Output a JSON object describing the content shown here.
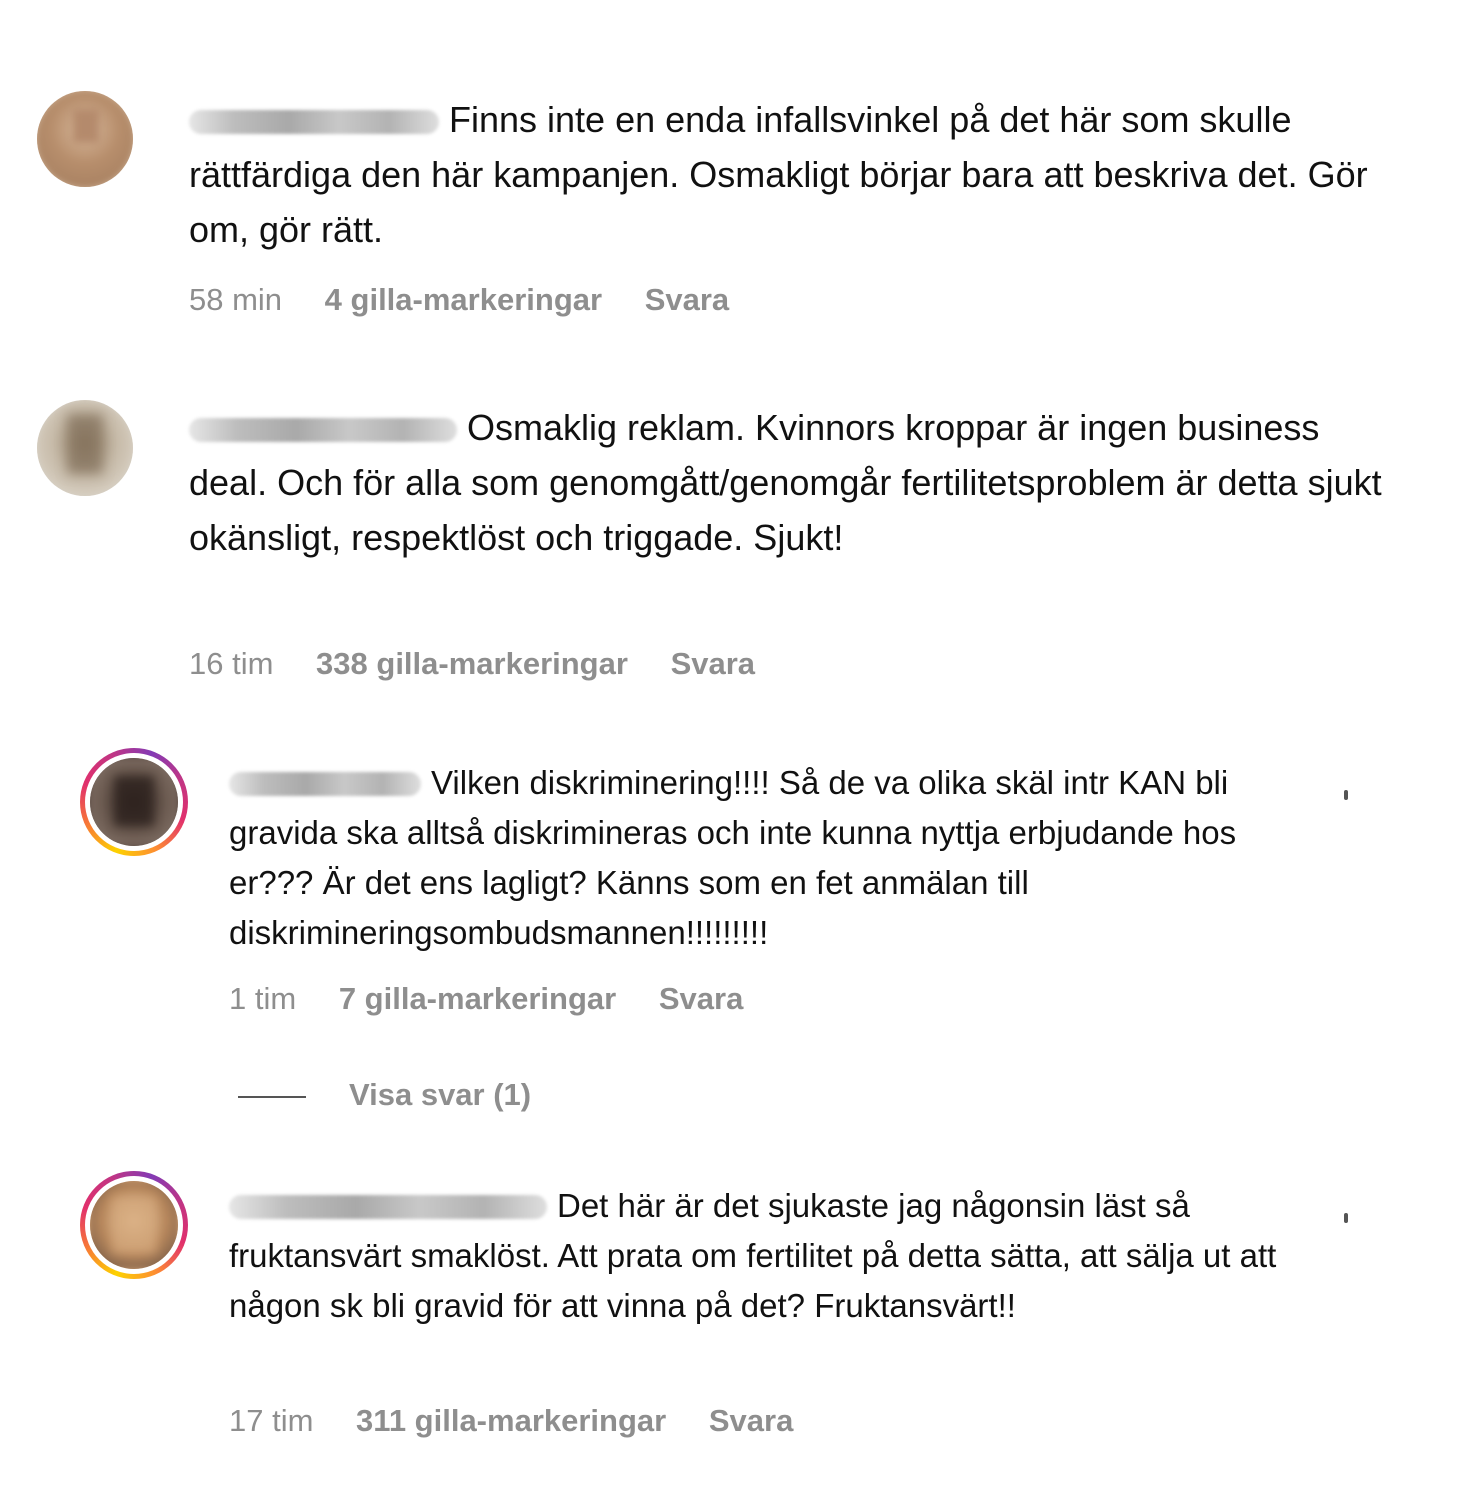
{
  "comments": [
    {
      "text": "Finns inte en enda infallsvinkel på det här som skulle rättfärdiga den här kampanjen. Osmakligt börjar bara att beskriva det. Gör om, gör rätt.",
      "time": "58 min",
      "likes": "4 gilla-markeringar",
      "reply": "Svara"
    },
    {
      "text": "Osmaklig reklam. Kvinnors kroppar är ingen business deal. Och för alla som genomgått/genomgår fertilitetsproblem är detta sjukt okänsligt, respektlöst och triggade. Sjukt!",
      "time": "16 tim",
      "likes": "338 gilla-markeringar",
      "reply": "Svara"
    },
    {
      "text": "Vilken diskriminering!!!! Så de va olika skäl intr KAN bli gravida ska alltså diskrimineras och inte kunna nyttja erbjudande hos er??? Är det ens lagligt? Känns som en fet anmälan till diskrimineringsombudsmannen!!!!!!!!!",
      "time": "1 tim",
      "likes": "7 gilla-markeringar",
      "reply": "Svara"
    },
    {
      "text": "Det här är det sjukaste jag någonsin läst så fruktansvärt smaklöst. Att prata om fertilitet på detta sätta, att sälja ut att någon sk bli gravid för att vinna på det? Fruktansvärt!!",
      "time": "17 tim",
      "likes": "311 gilla-markeringar",
      "reply": "Svara"
    }
  ],
  "show_replies": "Visa svar (1)",
  "colors": {
    "meta": "#8e8e8e",
    "text": "#111111",
    "story_ring": "gradient-yellow-pink-purple"
  }
}
